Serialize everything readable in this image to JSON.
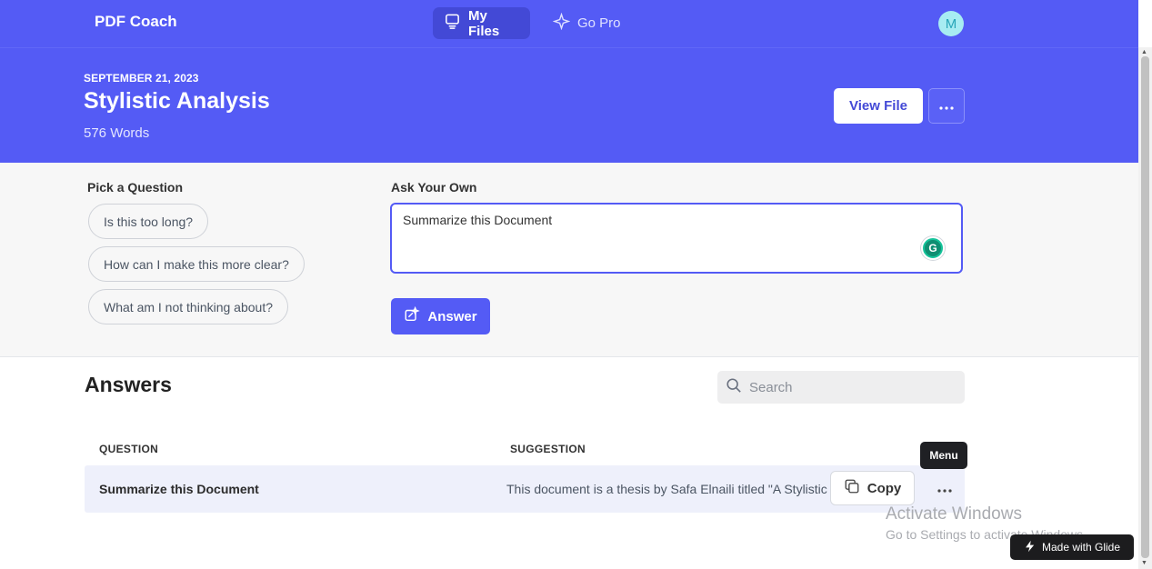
{
  "nav": {
    "brand": "PDF Coach",
    "tabs": [
      {
        "label": "My Files",
        "icon": "files-icon",
        "active": true
      },
      {
        "label": "Go Pro",
        "icon": "sparkle-icon",
        "active": false
      }
    ],
    "avatar_initial": "M"
  },
  "document": {
    "date": "SEPTEMBER 21, 2023",
    "title": "Stylistic Analysis",
    "word_count": "576 Words",
    "view_file_label": "View File"
  },
  "questions": {
    "pick_label": "Pick a Question",
    "chips": [
      "Is this too long?",
      "How can I make this more clear?",
      "What am I not thinking about?"
    ],
    "ask_label": "Ask Your Own",
    "ask_value": "Summarize this Document",
    "answer_label": "Answer"
  },
  "answers": {
    "title": "Answers",
    "search_placeholder": "Search",
    "columns": [
      "QUESTION",
      "SUGGESTION"
    ],
    "rows": [
      {
        "question": "Summarize this Document",
        "suggestion": "This document is a thesis by Safa Elnaili titled \"A Stylistic Analysis"
      }
    ],
    "copy_label": "Copy",
    "menu_tooltip": "Menu"
  },
  "watermark": {
    "line1": "Activate Windows",
    "line2": "Go to Settings to activate Windows.",
    "badge": "Made with Glide"
  },
  "colors": {
    "brand": "#545bf5",
    "brand_dark": "#4349d6"
  }
}
